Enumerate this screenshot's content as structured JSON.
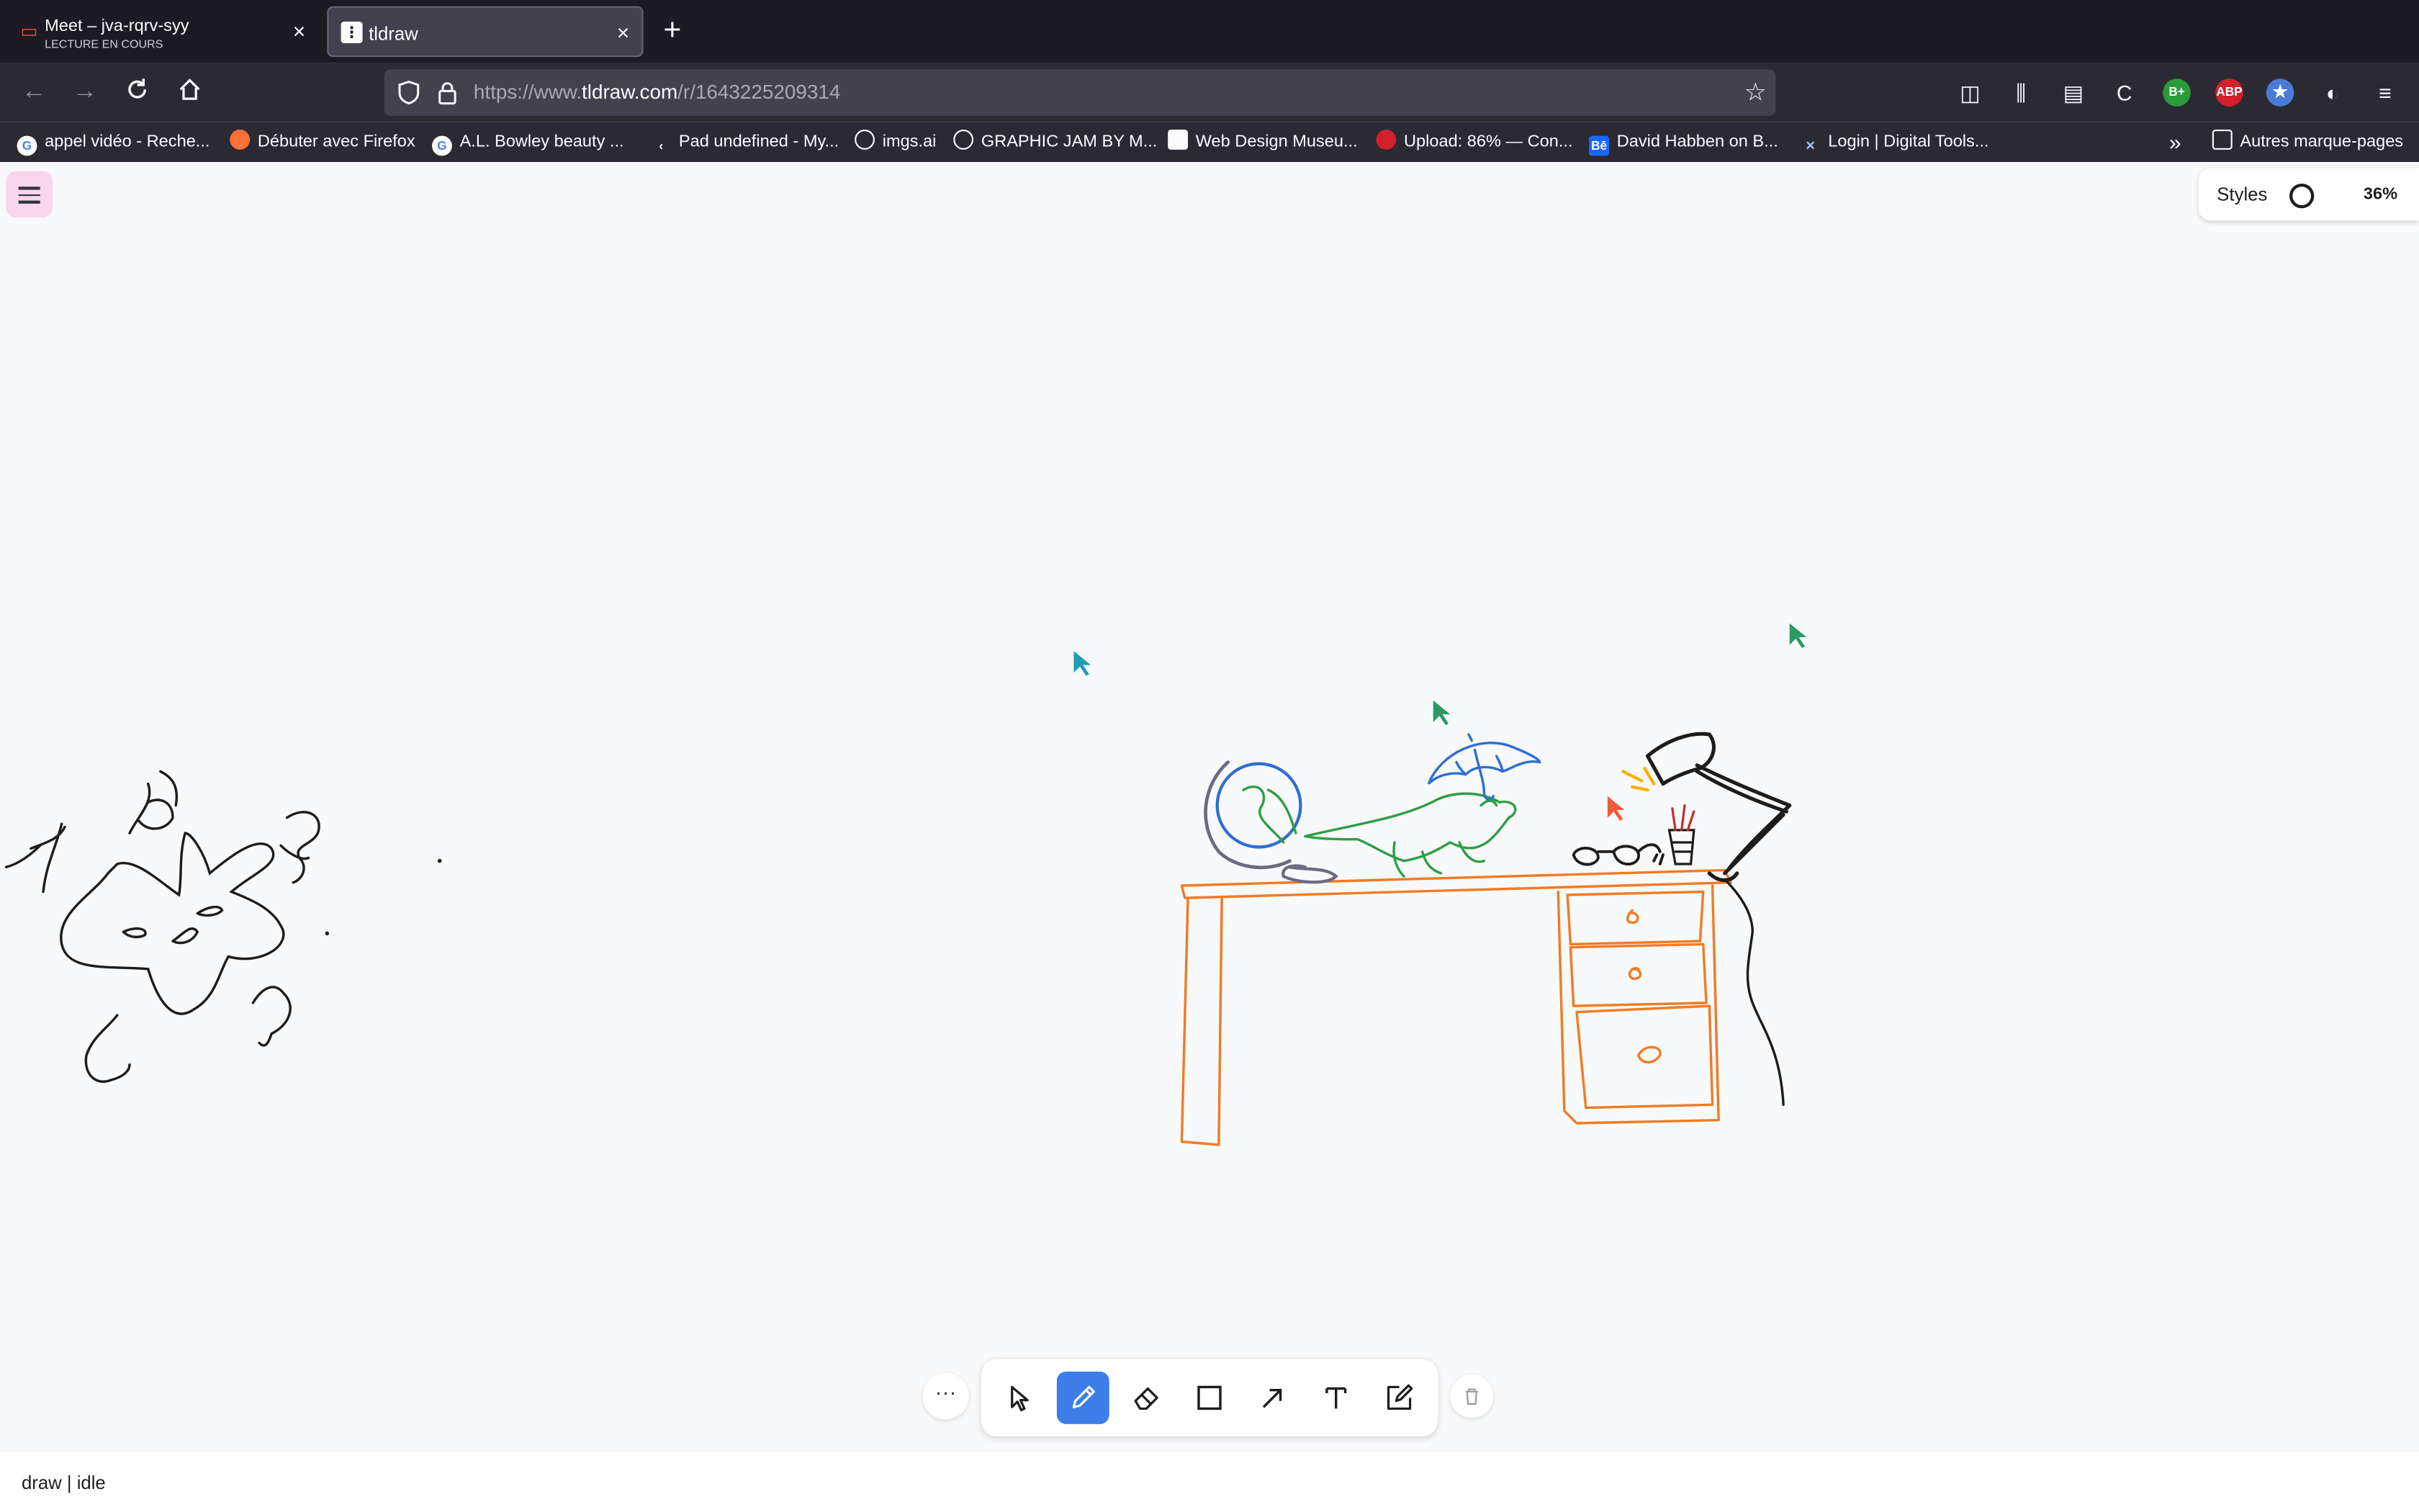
{
  "tabs": [
    {
      "title": "Meet – jva-rqrv-syy",
      "subtitle": "LECTURE EN COURS",
      "icon": "meet-icon"
    },
    {
      "title": "tldraw",
      "icon": "tldraw-icon"
    }
  ],
  "url": {
    "prefix": "https://www.",
    "domain": "tldraw.com",
    "path": "/r/1643225209314"
  },
  "bookmarks": [
    {
      "label": "appel vidéo - Reche...",
      "icon": "google-icon"
    },
    {
      "label": "Débuter avec Firefox",
      "icon": "firefox-icon"
    },
    {
      "label": "A.L. Bowley beauty ...",
      "icon": "google-icon"
    },
    {
      "label": "Pad undefined - My...",
      "icon": "pad-icon"
    },
    {
      "label": "imgs.ai",
      "icon": "globe-icon"
    },
    {
      "label": "GRAPHIC JAM BY M...",
      "icon": "globe-icon"
    },
    {
      "label": "Web Design Museu...",
      "icon": "museum-icon"
    },
    {
      "label": "Upload: 86% — Con...",
      "icon": "upload-icon"
    },
    {
      "label": "David Habben on B...",
      "icon": "behance-icon"
    },
    {
      "label": "Login | Digital Tools...",
      "icon": "digital-tools-icon"
    }
  ],
  "bookmarks_folder": "Autres marque-pages",
  "extensions": [
    {
      "name": "pocket-icon"
    },
    {
      "name": "library-icon"
    },
    {
      "name": "sidebar-icon"
    },
    {
      "name": "c-extension-icon"
    },
    {
      "name": "b-plus-extension",
      "label": "B+",
      "color": "#2a9d3a"
    },
    {
      "name": "adblock-extension",
      "label": "ABP",
      "color": "#d3202a"
    },
    {
      "name": "star-extension-icon",
      "color": "#4a7bd6"
    },
    {
      "name": "puzzle-icon"
    },
    {
      "name": "hamburger-menu-icon"
    }
  ],
  "tldraw": {
    "styles_label": "Styles",
    "zoom": "36%",
    "status": "draw | idle",
    "tools": [
      "select",
      "draw",
      "eraser",
      "rectangle",
      "arrow",
      "text",
      "sticky"
    ],
    "active_tool": "draw",
    "more_label": "···"
  },
  "colors": {
    "accent": "#3d7ee8",
    "desk": "#f07b26",
    "globe": "#2f6fd0",
    "dino": "#2f9e44",
    "ink": "#1d1d1d"
  }
}
